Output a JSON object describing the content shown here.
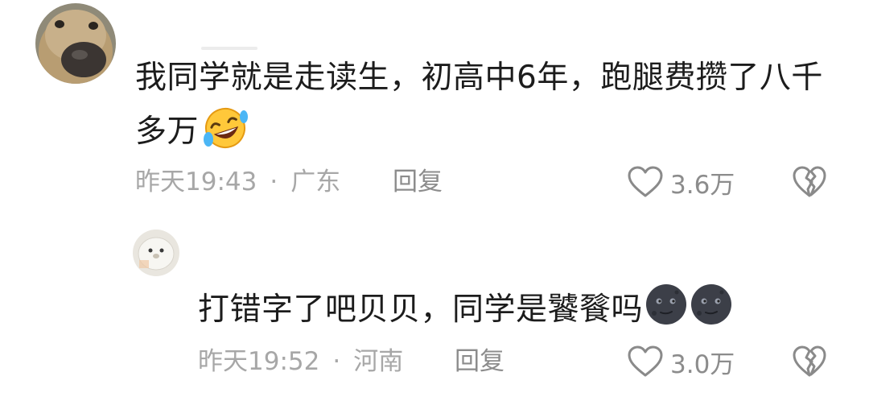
{
  "comments": [
    {
      "text_line1": "我同学就是走读生，初高中6年，跑腿费攒了八千",
      "text_line2": "多万",
      "emoji_icon": "rofl-emoji-icon",
      "time": "昨天19:43",
      "separator": "·",
      "location": "广东",
      "reply_label": "回复",
      "like_count": "3.6万",
      "like_icon": "heart-outline-icon",
      "dislike_icon": "broken-heart-icon"
    },
    {
      "text": "打错字了吧贝贝，同学是饕餮吗",
      "emoji_icon": "new-moon-face-emoji-icon",
      "time": "昨天19:52",
      "separator": "·",
      "location": "河南",
      "reply_label": "回复",
      "like_count": "3.0万",
      "like_icon": "heart-outline-icon",
      "dislike_icon": "broken-heart-icon"
    }
  ],
  "colors": {
    "text": "#1c1c1c",
    "meta": "#a7a7a7",
    "action": "#8c8c8c"
  }
}
